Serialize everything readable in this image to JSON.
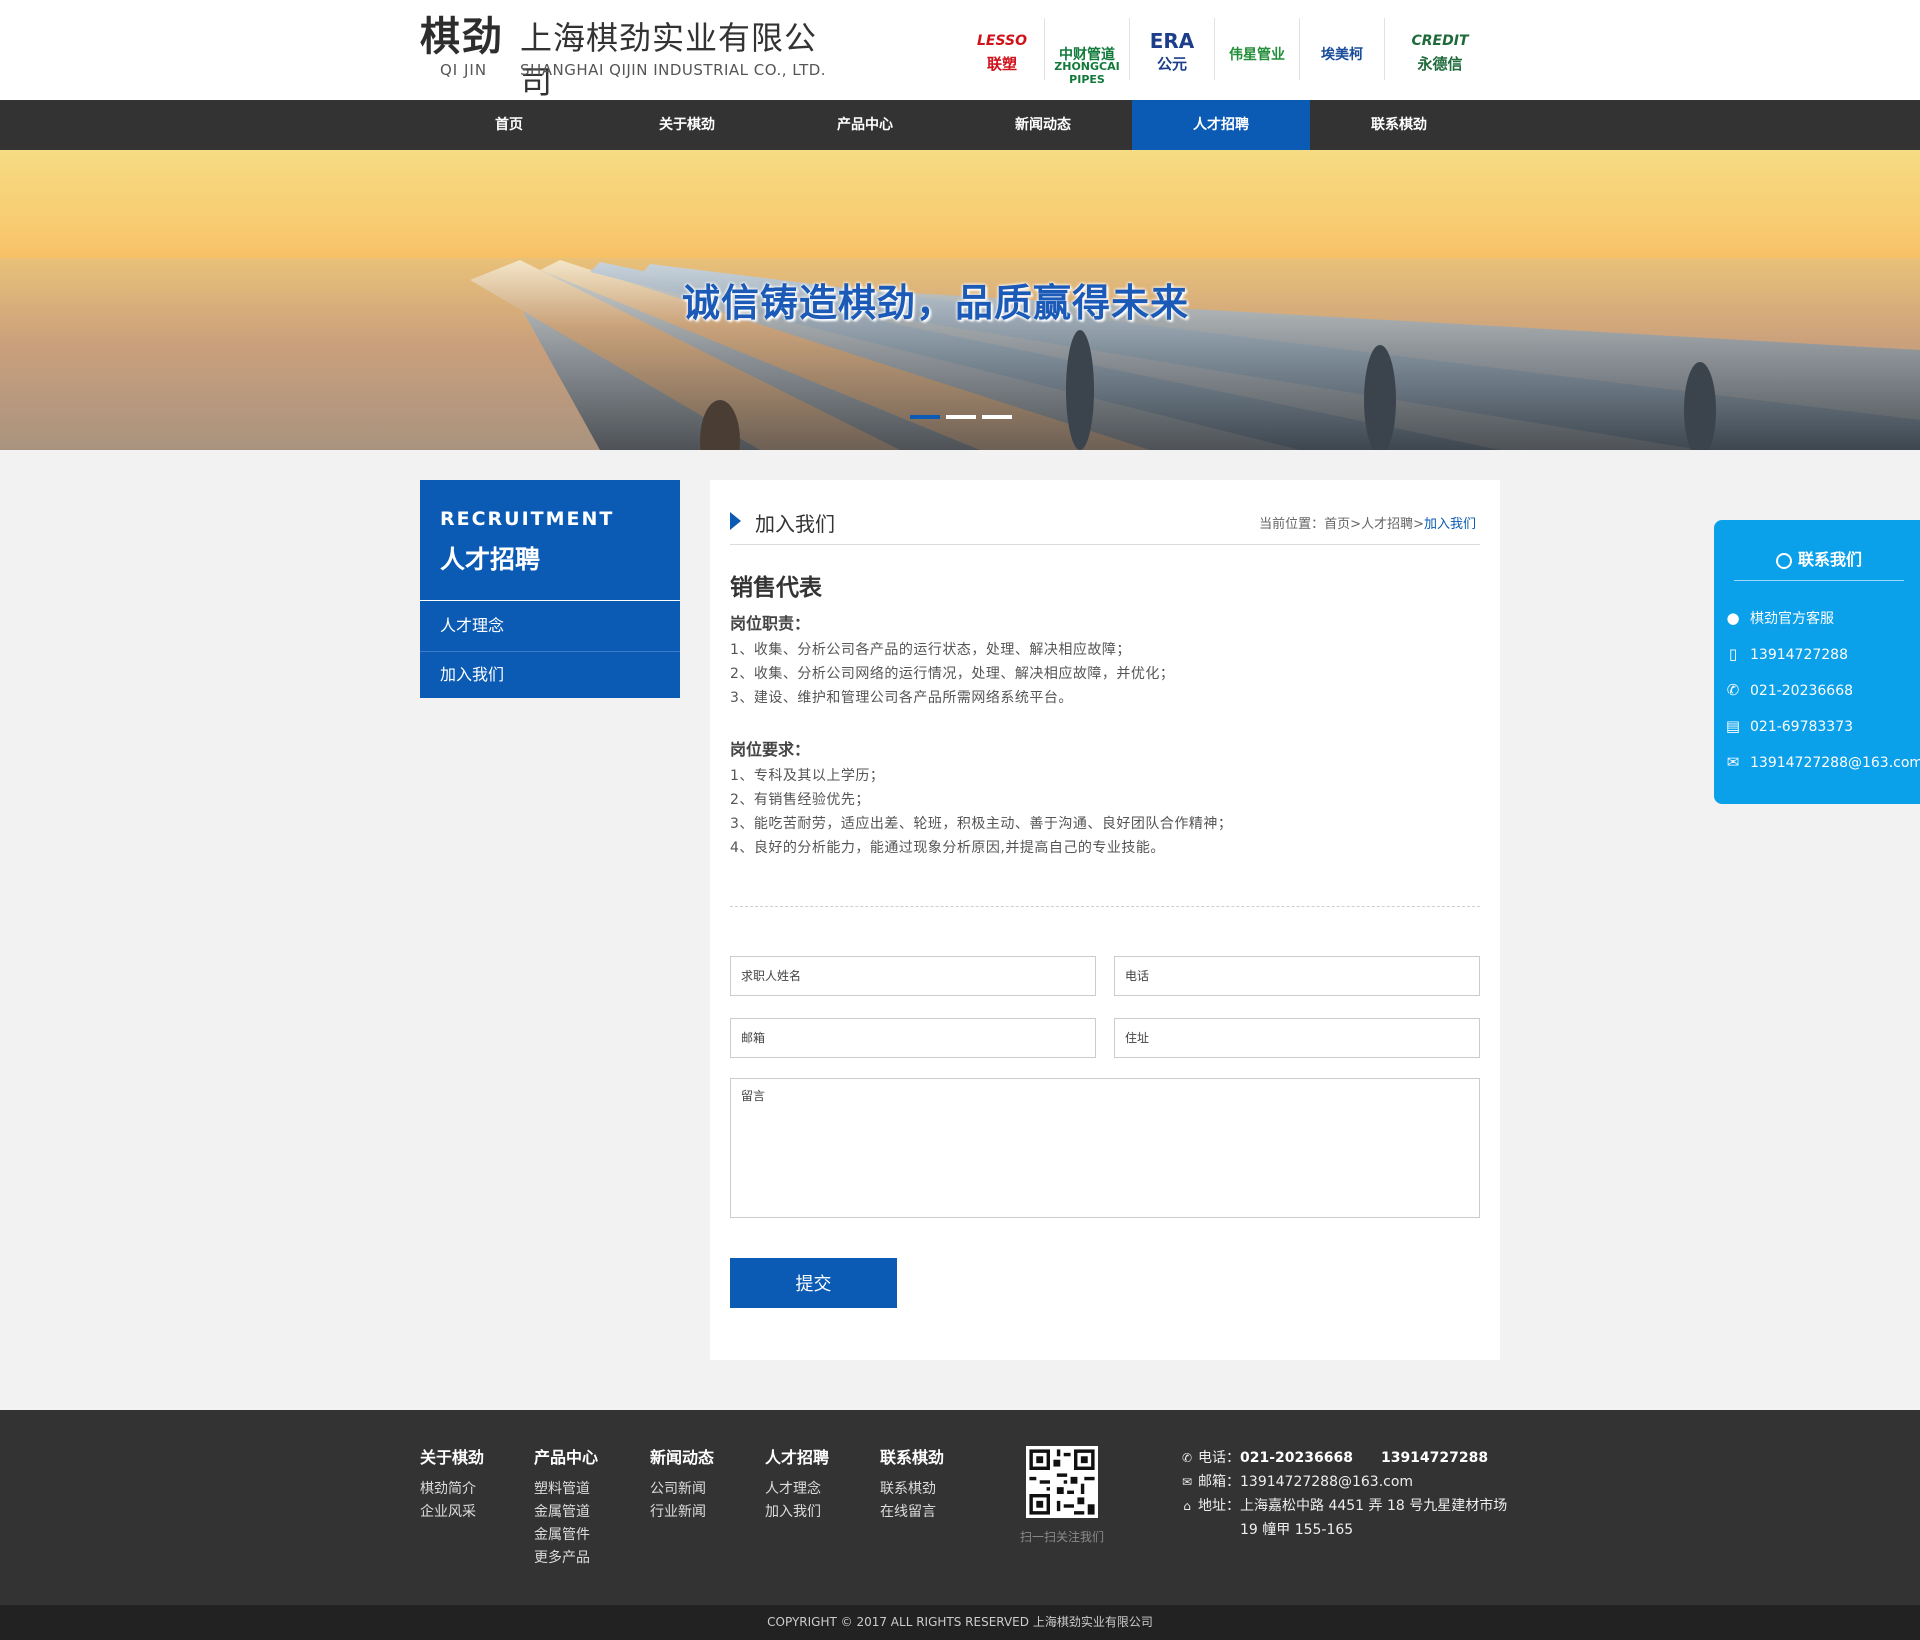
{
  "header": {
    "logo_mark": "棋劲",
    "logo_pinyin": "QI JIN",
    "company_cn": "上海棋劲实业有限公司",
    "company_en": "SHANGHAI QIJIN INDUSTRIAL CO., LTD.",
    "brands": [
      {
        "name": "LESSO",
        "sub": "联塑",
        "color": "#d0121b"
      },
      {
        "name": "中财管道",
        "sub": "ZHONGCAI PIPES",
        "color": "#117a3b"
      },
      {
        "name": "ERA",
        "sub": "公元",
        "color": "#1d3f8a"
      },
      {
        "name": "伟星管业",
        "sub": "",
        "color": "#238d3a"
      },
      {
        "name": "埃美柯",
        "sub": "",
        "color": "#1a4c9a"
      },
      {
        "name": "CREDIT",
        "sub": "永德信",
        "color": "#1f6a3a"
      }
    ]
  },
  "nav": {
    "items": [
      "首页",
      "关于棋劲",
      "产品中心",
      "新闻动态",
      "人才招聘",
      "联系棋劲"
    ],
    "active_index": 4,
    "accent": "#0b5bb5"
  },
  "banner": {
    "slogan": "诚信铸造棋劲，品质赢得未来",
    "slides": 3,
    "active_slide": 0
  },
  "sidebar": {
    "title_en": "RECRUITMENT",
    "title_cn": "人才招聘",
    "items": [
      "人才理念",
      "加入我们"
    ]
  },
  "main": {
    "title": "加入我们",
    "breadcrumb": {
      "label": "当前位置：",
      "home": "首页",
      "section": "人才招聘",
      "current": "加入我们",
      "sep": ">"
    },
    "job_title": "销售代表",
    "duties_title": "岗位职责：",
    "duties": [
      "1、收集、分析公司各产品的运行状态，处理、解决相应故障；",
      "2、收集、分析公司网络的运行情况，处理、解决相应故障，并优化；",
      "3、建设、维护和管理公司各产品所需网络系统平台。"
    ],
    "requirements_title": "岗位要求：",
    "requirements": [
      "1、专科及其以上学历；",
      "2、有销售经验优先；",
      "3、能吃苦耐劳，适应出差、轮班，积极主动、善于沟通、良好团队合作精神；",
      "4、良好的分析能力，能通过现象分析原因,并提高自己的专业技能。"
    ],
    "form": {
      "name_placeholder": "求职人姓名",
      "phone_placeholder": "电话",
      "email_placeholder": "邮箱",
      "address_placeholder": "住址",
      "message_placeholder": "留言",
      "submit_label": "提交"
    }
  },
  "float_contact": {
    "title": "联系我们",
    "qq": "棋劲官方客服",
    "mobile": "13914727288",
    "phone": "021-20236668",
    "fax": "021-69783373",
    "email": "13914727288@163.com",
    "color": "#0aa0ea"
  },
  "footer": {
    "columns": [
      {
        "title": "关于棋劲",
        "links": [
          "棋劲简介",
          "企业风采"
        ]
      },
      {
        "title": "产品中心",
        "links": [
          "塑料管道",
          "金属管道",
          "金属管件",
          "更多产品"
        ]
      },
      {
        "title": "新闻动态",
        "links": [
          "公司新闻",
          "行业新闻"
        ]
      },
      {
        "title": "人才招聘",
        "links": [
          "人才理念",
          "加入我们"
        ]
      },
      {
        "title": "联系棋劲",
        "links": [
          "联系棋劲",
          "在线留言"
        ]
      }
    ],
    "qr_caption": "扫一扫关注我们",
    "phone_label": "电话：",
    "phone_values": "021-20236668　　13914727288",
    "email_label": "邮箱：",
    "email_value": "13914727288@163.com",
    "address_label": "地址：",
    "address_line1": "上海嘉松中路 4451 弄 18 号九星建材市场",
    "address_line2": "19 幢甲 155-165",
    "copyright": "COPYRIGHT © 2017 ALL RIGHTS RESERVED 上海棋劲实业有限公司"
  }
}
